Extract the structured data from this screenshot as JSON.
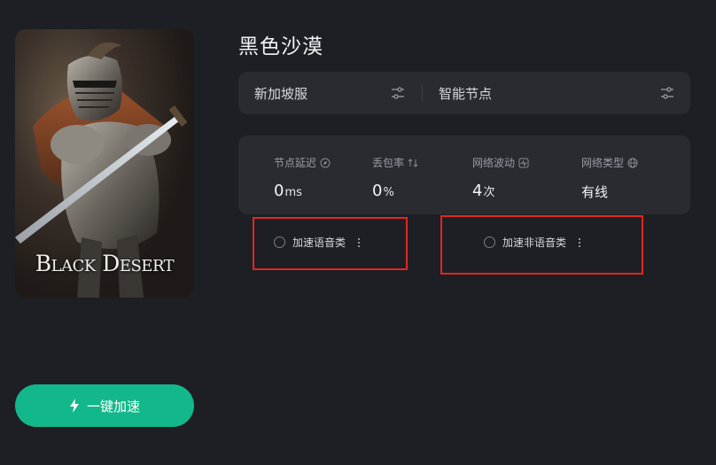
{
  "cover": {
    "logo_text": "Black Desert",
    "alt": "Black Desert cover art"
  },
  "boost_button": {
    "label": "一键加速",
    "icon": "lightning-bolt-icon"
  },
  "game": {
    "title": "黑色沙漠"
  },
  "selector": {
    "server": "新加坡服",
    "node": "智能节点",
    "filter_icon": "sliders-icon"
  },
  "stats": [
    {
      "label": "节点延迟",
      "value": "0",
      "unit": "ms",
      "icon": "compass-icon"
    },
    {
      "label": "丢包率",
      "value": "0",
      "unit": "%",
      "icon": "arrows-updown-icon"
    },
    {
      "label": "网络波动",
      "value": "4",
      "unit": "次",
      "icon": "pulse-icon"
    },
    {
      "label": "网络类型",
      "value": "有线",
      "unit": "",
      "icon": "globe-icon"
    }
  ],
  "options": [
    {
      "label": "加速语音类",
      "checked": false
    },
    {
      "label": "加速非语音类",
      "checked": false
    }
  ],
  "colors": {
    "background": "#1e1f24",
    "card": "#2a2b31",
    "accent": "#12b88a",
    "highlight_border": "#e3261f"
  }
}
